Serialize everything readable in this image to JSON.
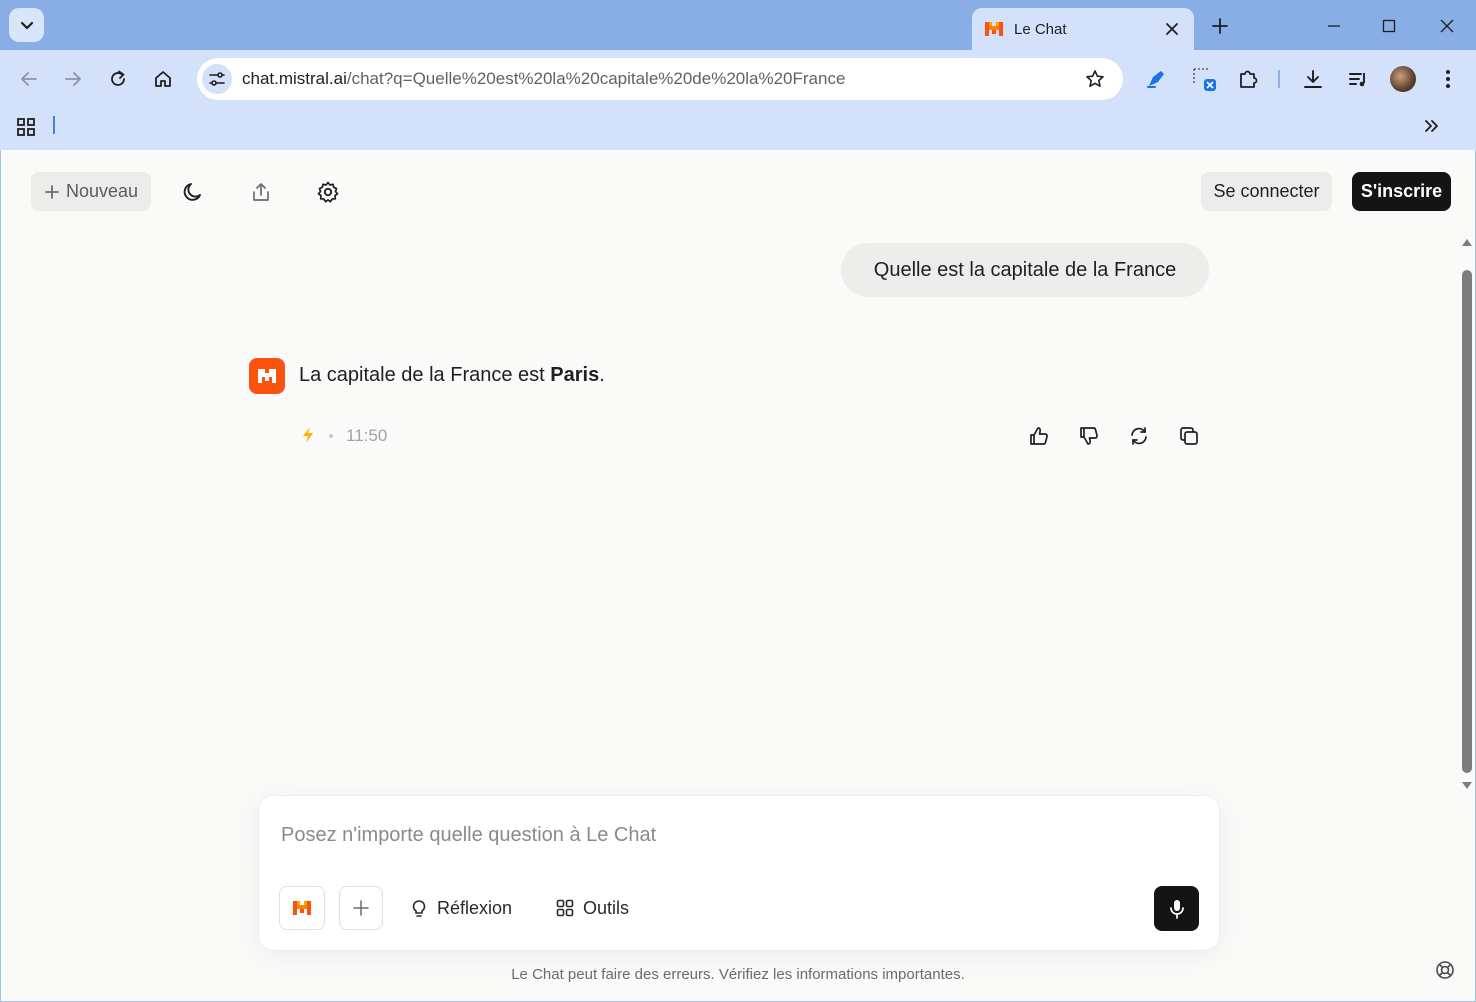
{
  "browser": {
    "tab": {
      "title": "Le Chat"
    },
    "address": {
      "host": "chat.mistral.ai",
      "path": "/chat?q=Quelle%20est%20la%20capitale%20de%20la%20France"
    }
  },
  "header": {
    "new_label": "Nouveau",
    "login_label": "Se connecter",
    "signup_label": "S'inscrire"
  },
  "conversation": {
    "user_message": "Quelle est la capitale de la France",
    "bot_message_prefix": "La capitale de la France est ",
    "bot_message_bold": "Paris",
    "bot_message_suffix": ".",
    "timestamp": "11:50"
  },
  "composer": {
    "placeholder": "Posez n'importe quelle question à Le Chat",
    "reflexion_label": "Réflexion",
    "tools_label": "Outils"
  },
  "footer": {
    "disclaimer": "Le Chat peut faire des erreurs. Vérifiez les informations importantes."
  },
  "colors": {
    "brand_orange": "#fa520f",
    "chrome_blue": "#d3e2fa",
    "titlebar_blue": "#89aee6",
    "dark_button": "#141414"
  },
  "icons": [
    "tab-search-icon",
    "mistral-logo-icon",
    "close-icon",
    "plus-icon",
    "minimize-icon",
    "maximize-icon",
    "back-arrow-icon",
    "forward-arrow-icon",
    "reload-icon",
    "home-icon",
    "site-settings-icon",
    "star-icon",
    "pen-extension-icon",
    "translate-extension-icon",
    "puzzle-extension-icon",
    "download-icon",
    "media-control-icon",
    "more-vert-icon",
    "apps-grid-icon",
    "chevron-double-right-icon",
    "moon-icon",
    "share-icon",
    "gear-icon",
    "bolt-icon",
    "thumbs-up-icon",
    "thumbs-down-icon",
    "refresh-icon",
    "copy-icon",
    "lightbulb-icon",
    "tools-grid-icon",
    "mic-icon",
    "help-lifebuoy-icon"
  ]
}
